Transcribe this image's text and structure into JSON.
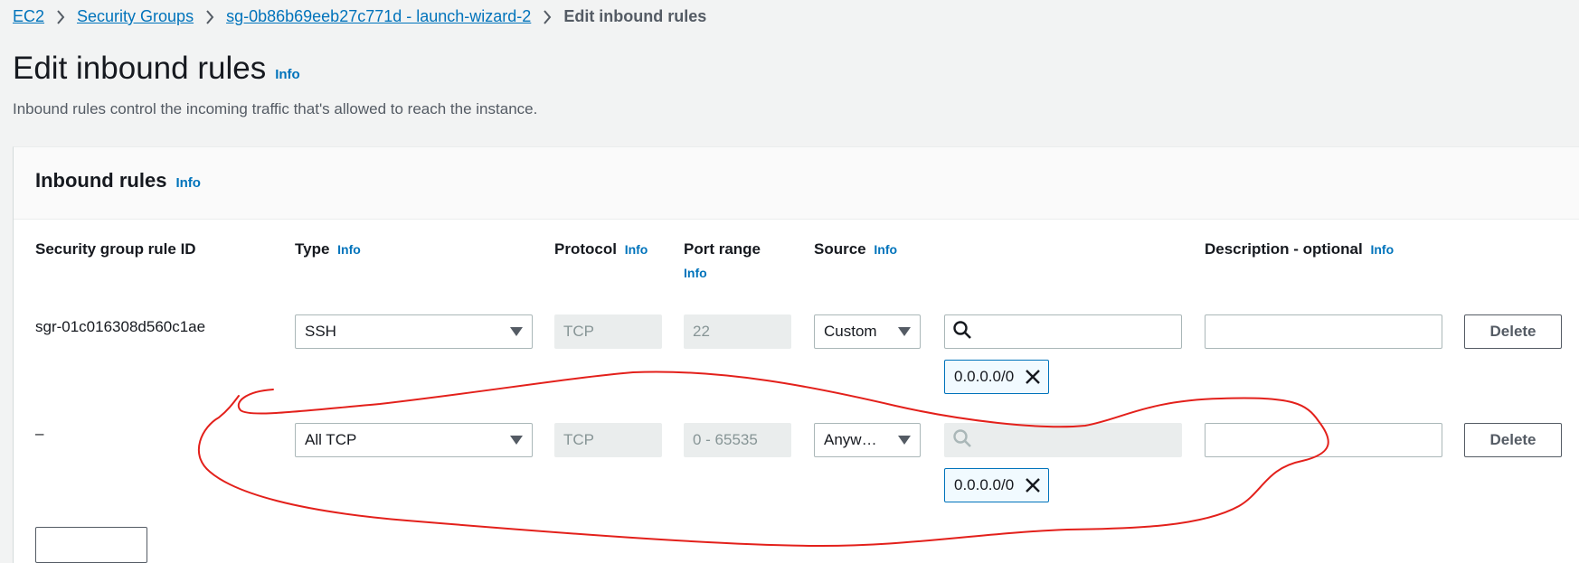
{
  "breadcrumb": {
    "items": [
      "EC2",
      "Security Groups",
      "sg-0b86b69eeb27c771d - launch-wizard-2"
    ],
    "current": "Edit inbound rules"
  },
  "page": {
    "title": "Edit inbound rules",
    "info": "Info",
    "description": "Inbound rules control the incoming traffic that's allowed to reach the instance."
  },
  "panel": {
    "title": "Inbound rules",
    "info": "Info",
    "columns": {
      "rule_id": "Security group rule ID",
      "type": "Type",
      "protocol": "Protocol",
      "port_range": "Port range",
      "source": "Source",
      "description": "Description - optional",
      "info": "Info"
    }
  },
  "rules": [
    {
      "id": "sgr-01c016308d560c1ae",
      "type": "SSH",
      "protocol": "TCP",
      "port_range": "22",
      "source_type": "Custom",
      "source_token": "0.0.0.0/0",
      "description": "",
      "delete_label": "Delete"
    },
    {
      "id": "–",
      "type": "All TCP",
      "protocol": "TCP",
      "port_range": "0 - 65535",
      "source_type": "Anyw…",
      "source_token": "0.0.0.0/0",
      "description": "",
      "delete_label": "Delete"
    }
  ],
  "icons": {
    "breadcrumb_separator": "chevron-right-icon",
    "dropdown": "caret-down-icon",
    "search": "search-icon",
    "remove": "close-icon"
  },
  "colors": {
    "link": "#0073bb",
    "annotation": "#e3201b"
  }
}
